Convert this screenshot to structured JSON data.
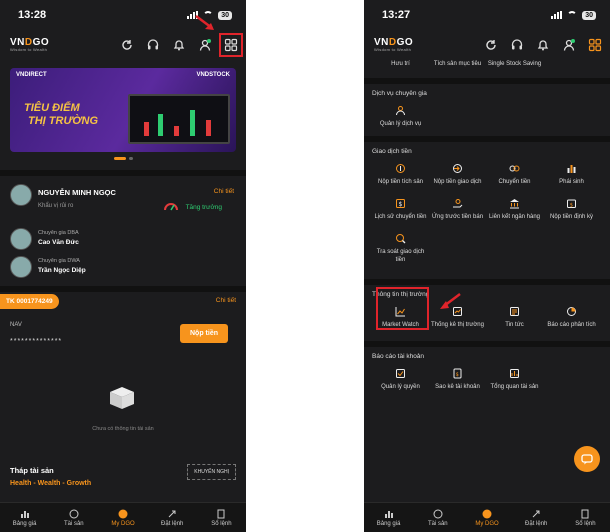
{
  "left": {
    "status": {
      "time": "13:28",
      "battery": "30"
    },
    "logo": {
      "brand_prefix": "VN",
      "brand_mid": "D",
      "brand_suffix": "GO",
      "tagline": "Wisdom to Wealth"
    },
    "banner": {
      "left_brand": "VNDIRECT",
      "right_brand": "VNDSTOCK",
      "headline_1": "TIÊU ĐIỂM",
      "headline_2": "THỊ TRƯỜNG"
    },
    "profile": {
      "name": "NGUYỄN MINH NGỌC",
      "detail": "Chi tiết",
      "risk_label": "Khẩu vị rủi ro",
      "risk_value": "Tăng trưởng",
      "expert1_role": "Chuyên gia DBA",
      "expert1_name": "Cao Văn Đức",
      "expert2_role": "Chuyên gia DWA",
      "expert2_name": "Trần Ngọc Diệp"
    },
    "account": {
      "id": "TK 0001774249",
      "detail": "Chi tiết",
      "nav_label": "NAV",
      "nav_masked": "**************",
      "deposit_button": "Nộp tiền",
      "empty_text": "Chưa có thông tin tài sản"
    },
    "assets": {
      "title": "Tháp tài sản",
      "subtitle": "Health - Wealth - Growth",
      "recommend": "KHUYẾN NGHỊ"
    }
  },
  "right": {
    "status": {
      "time": "13:27",
      "battery": "30"
    },
    "top_row": [
      "Hưu trí",
      "Tích sản mục tiêu",
      "Single Stock Saving"
    ],
    "dich_vu": {
      "title": "Dịch vụ chuyên gia",
      "items": [
        "Quản lý dịch vụ"
      ]
    },
    "giao_dich": {
      "title": "Giao dịch tiền",
      "row1": [
        "Nộp tiền tích sản",
        "Nộp tiền giao dịch",
        "Chuyển tiền",
        "Phái sinh"
      ],
      "row2": [
        "Lịch sử chuyển tiền",
        "Ứng trước tiền bán",
        "Liên kết ngân hàng",
        "Nộp tiền định kỳ"
      ],
      "row3": [
        "Tra soát giao dịch tiền"
      ]
    },
    "thi_truong": {
      "title": "Thông tin thị trường",
      "items": [
        "Market Watch",
        "Thống kê thị trường",
        "Tin tức",
        "Báo cáo phân tích"
      ]
    },
    "bao_cao": {
      "title": "Báo cáo tài khoản",
      "items": [
        "Quản lý quyền",
        "Sao kê tài khoản",
        "Tổng quan tài sản"
      ]
    }
  },
  "bottom_nav": [
    "Bảng giá",
    "Tài sản",
    "My DGO",
    "Đặt lệnh",
    "Sổ lệnh"
  ],
  "colors": {
    "accent": "#f7941d",
    "background": "#1c1c1e",
    "highlight": "#e0242b",
    "growth": "#2ecc71"
  }
}
